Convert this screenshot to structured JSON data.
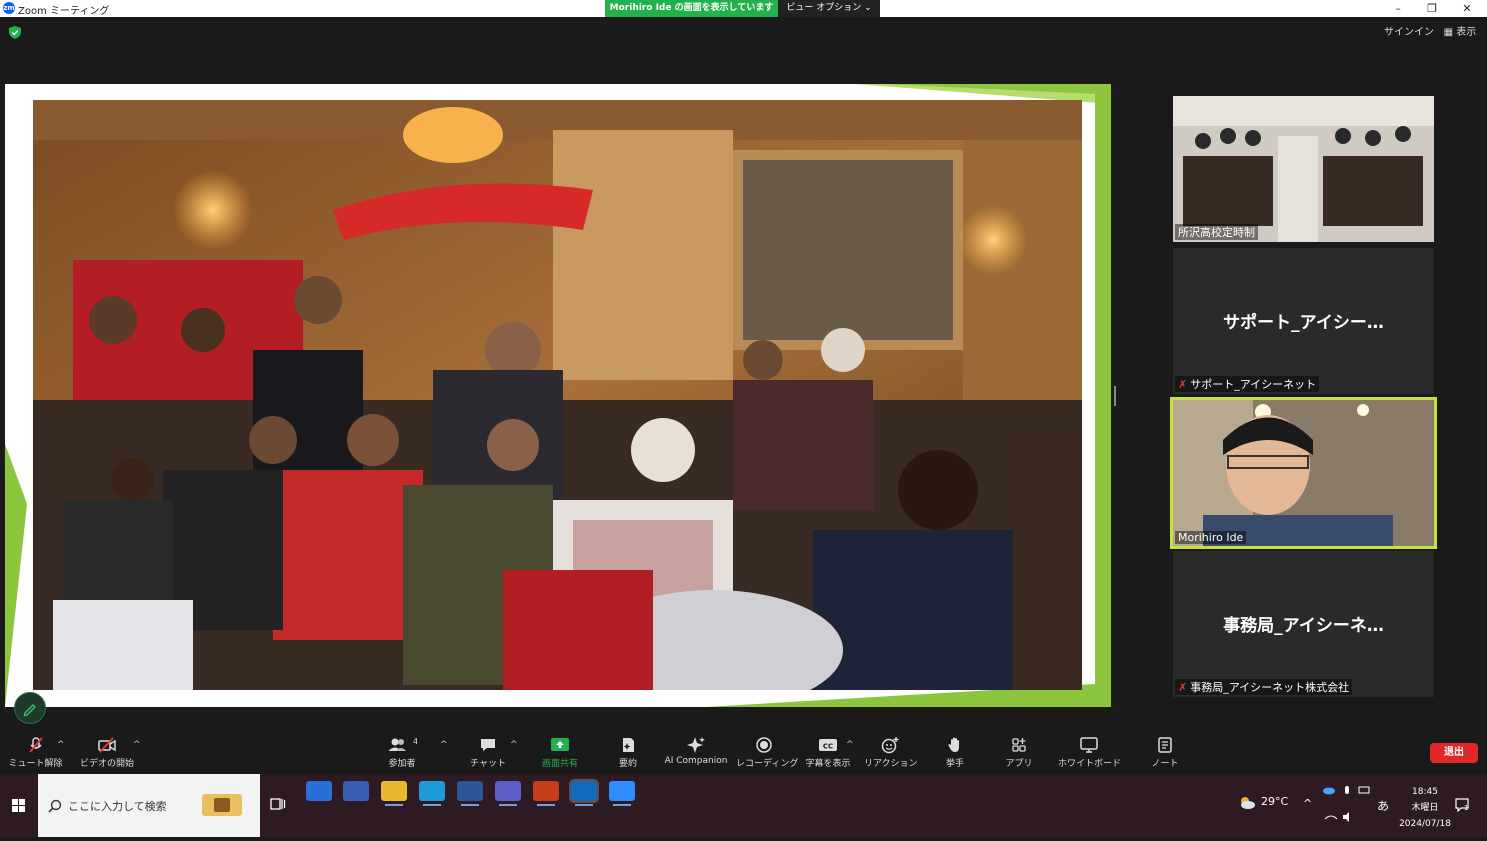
{
  "titlebar": {
    "app_logo": "zm",
    "title": "Zoom ミーティング",
    "minimize": "–",
    "restore": "❐",
    "close": "✕"
  },
  "share_banner": {
    "text": "Morihiro Ide の画面を表示しています",
    "view_options": "ビュー オプション ⌄"
  },
  "header": {
    "sign_in": "サインイン",
    "view": "▦ 表示"
  },
  "participants": [
    {
      "name": "所沢高校定時制",
      "has_video": true
    },
    {
      "name": "サポート_アイシーネット",
      "display": "サポート_アイシー…",
      "muted": true
    },
    {
      "name": "Morihiro Ide",
      "has_video": true,
      "speaking": true
    },
    {
      "name": "事務局_アイシーネット株式会社",
      "display": "事務局_アイシーネ…",
      "muted": true
    }
  ],
  "toolbar": {
    "mute": "ミュート解除",
    "video": "ビデオの開始",
    "participants": "参加者",
    "participants_count": "4",
    "chat": "チャット",
    "share": "画面共有",
    "summary": "要約",
    "ai": "AI Companion",
    "record": "レコーディング",
    "captions": "字幕を表示",
    "reactions": "リアクション",
    "raise_hand": "挙手",
    "apps": "アプリ",
    "whiteboard": "ホワイトボード",
    "notes": "ノート",
    "leave": "退出",
    "cc": "CC"
  },
  "taskbar": {
    "search_placeholder": "ここに入力して検索",
    "weather": "29°C",
    "time": "18:45",
    "ime": "あ",
    "day": "木曜日",
    "date": "2024/07/18",
    "notifications": "1"
  },
  "colors": {
    "share_green": "#23b14d",
    "speaker_border": "#c7e23d",
    "leave_red": "#e02828",
    "slide_green": "#8cc63f"
  }
}
